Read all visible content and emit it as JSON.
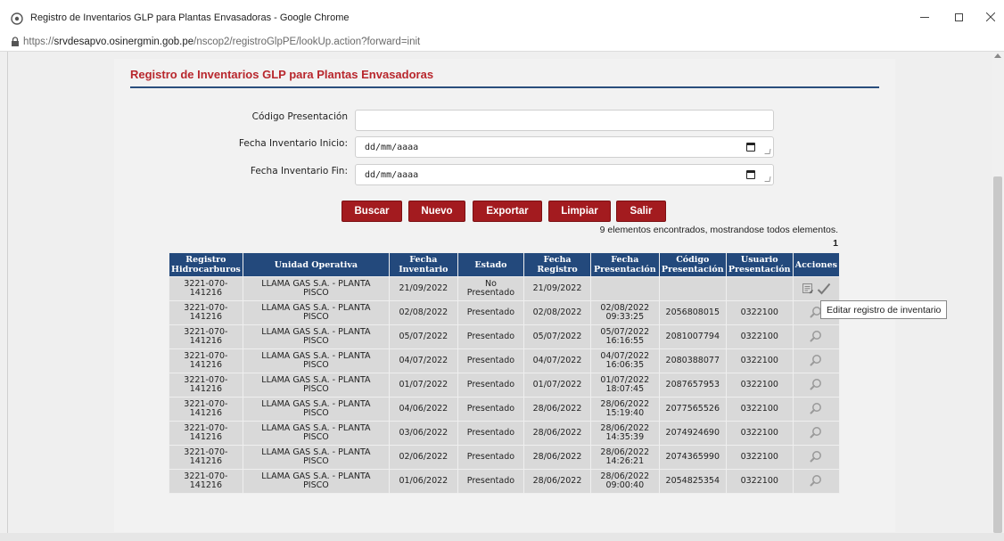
{
  "window": {
    "title": "Registro de Inventarios GLP para Plantas Envasadoras - Google Chrome",
    "url_scheme": "https://",
    "url_host": "srvdesapvo.osinergmin.gob.pe",
    "url_path": "/nscop2/registroGlpPE/lookUp.action?forward=init"
  },
  "page": {
    "title": "Registro de Inventarios GLP para Plantas Envasadoras"
  },
  "form": {
    "codigo_label": "Código Presentación",
    "codigo_value": "",
    "fecha_inicio_label": "Fecha Inventario Inicio:",
    "fecha_inicio_value": "dd/mm/aaaa",
    "fecha_fin_label": "Fecha Inventario Fin:",
    "fecha_fin_value": "dd/mm/aaaa"
  },
  "buttons": {
    "buscar": "Buscar",
    "nuevo": "Nuevo",
    "exportar": "Exportar",
    "limpiar": "Limpiar",
    "salir": "Salir"
  },
  "results": {
    "info": "9 elementos encontrados, mostrandose todos elementos.",
    "page": "1"
  },
  "table": {
    "headers": {
      "reg1": "Registro",
      "reg2": "Hidrocarburos",
      "op": "Unidad Operativa",
      "fi1": "Fecha",
      "fi2": "Inventario",
      "est": "Estado",
      "fr1": "Fecha",
      "fr2": "Registro",
      "fp1": "Fecha",
      "fp2": "Presentación",
      "cp1": "Código",
      "cp2": "Presentación",
      "up1": "Usuario",
      "up2": "Presentación",
      "act": "Acciones"
    },
    "rows": [
      {
        "reg1": "3221-070-",
        "reg2": "141216",
        "op1": "LLAMA GAS S.A. - PLANTA",
        "op2": "PISCO",
        "fi": "21/09/2022",
        "est1": "No",
        "est2": "Presentado",
        "fr": "21/09/2022",
        "fp1": "",
        "fp2": "",
        "cp": "",
        "up": ""
      },
      {
        "reg1": "3221-070-",
        "reg2": "141216",
        "op1": "LLAMA GAS S.A. - PLANTA",
        "op2": "PISCO",
        "fi": "02/08/2022",
        "est1": "Presentado",
        "est2": "",
        "fr": "02/08/2022",
        "fp1": "02/08/2022",
        "fp2": "09:33:25",
        "cp": "2056808015",
        "up": "0322100"
      },
      {
        "reg1": "3221-070-",
        "reg2": "141216",
        "op1": "LLAMA GAS S.A. - PLANTA",
        "op2": "PISCO",
        "fi": "05/07/2022",
        "est1": "Presentado",
        "est2": "",
        "fr": "05/07/2022",
        "fp1": "05/07/2022",
        "fp2": "16:16:55",
        "cp": "2081007794",
        "up": "0322100"
      },
      {
        "reg1": "3221-070-",
        "reg2": "141216",
        "op1": "LLAMA GAS S.A. - PLANTA",
        "op2": "PISCO",
        "fi": "04/07/2022",
        "est1": "Presentado",
        "est2": "",
        "fr": "04/07/2022",
        "fp1": "04/07/2022",
        "fp2": "16:06:35",
        "cp": "2080388077",
        "up": "0322100"
      },
      {
        "reg1": "3221-070-",
        "reg2": "141216",
        "op1": "LLAMA GAS S.A. - PLANTA",
        "op2": "PISCO",
        "fi": "01/07/2022",
        "est1": "Presentado",
        "est2": "",
        "fr": "01/07/2022",
        "fp1": "01/07/2022",
        "fp2": "18:07:45",
        "cp": "2087657953",
        "up": "0322100"
      },
      {
        "reg1": "3221-070-",
        "reg2": "141216",
        "op1": "LLAMA GAS S.A. - PLANTA",
        "op2": "PISCO",
        "fi": "04/06/2022",
        "est1": "Presentado",
        "est2": "",
        "fr": "28/06/2022",
        "fp1": "28/06/2022",
        "fp2": "15:19:40",
        "cp": "2077565526",
        "up": "0322100"
      },
      {
        "reg1": "3221-070-",
        "reg2": "141216",
        "op1": "LLAMA GAS S.A. - PLANTA",
        "op2": "PISCO",
        "fi": "03/06/2022",
        "est1": "Presentado",
        "est2": "",
        "fr": "28/06/2022",
        "fp1": "28/06/2022",
        "fp2": "14:35:39",
        "cp": "2074924690",
        "up": "0322100"
      },
      {
        "reg1": "3221-070-",
        "reg2": "141216",
        "op1": "LLAMA GAS S.A. - PLANTA",
        "op2": "PISCO",
        "fi": "02/06/2022",
        "est1": "Presentado",
        "est2": "",
        "fr": "28/06/2022",
        "fp1": "28/06/2022",
        "fp2": "14:26:21",
        "cp": "2074365990",
        "up": "0322100"
      },
      {
        "reg1": "3221-070-",
        "reg2": "141216",
        "op1": "LLAMA GAS S.A. - PLANTA",
        "op2": "PISCO",
        "fi": "01/06/2022",
        "est1": "Presentado",
        "est2": "",
        "fr": "28/06/2022",
        "fp1": "28/06/2022",
        "fp2": "09:00:40",
        "cp": "2054825354",
        "up": "0322100"
      }
    ]
  },
  "tooltip": "Editar registro de inventario",
  "icons": {
    "edit": "edit-icon",
    "check": "check-icon",
    "view": "magnifier-icon"
  },
  "colors": {
    "brand_red": "#a31b1f",
    "title_red": "#b8272d",
    "header_blue": "#23497c"
  }
}
